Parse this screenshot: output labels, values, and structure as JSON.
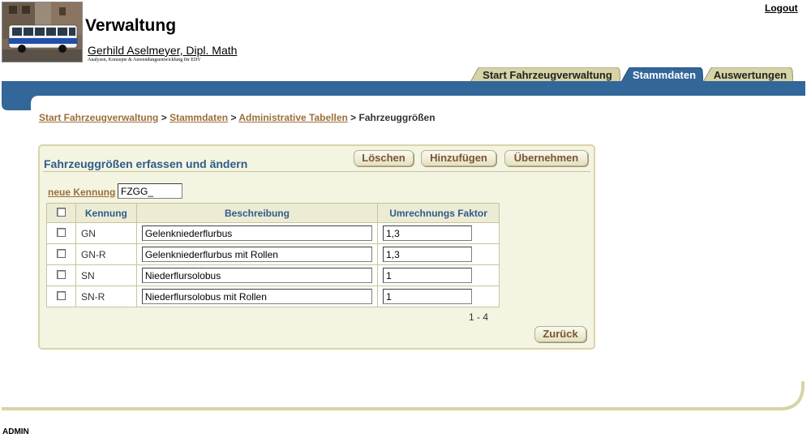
{
  "header": {
    "app_title": "Verwaltung",
    "subtitle_name": "Gerhild Aselmeyer, Dipl. Math",
    "subtitle_tagline": "Analysen, Konzepte & Anwendungsentwicklung für EDV",
    "logout_label": "Logout"
  },
  "tabs": [
    {
      "label": "Start Fahrzeugverwaltung",
      "active": false
    },
    {
      "label": "Stammdaten",
      "active": true
    },
    {
      "label": "Auswertungen",
      "active": false
    }
  ],
  "breadcrumb": {
    "items": [
      "Start Fahrzeugverwaltung",
      "Stammdaten",
      "Administrative Tabellen"
    ],
    "separator": ">",
    "current": "Fahrzeuggrößen"
  },
  "panel": {
    "title": "Fahrzeuggrößen erfassen und ändern",
    "buttons": {
      "delete": "Löschen",
      "add": "Hinzufügen",
      "apply": "Übernehmen",
      "back": "Zurück"
    },
    "new_kennung_label": "neue Kennung",
    "new_kennung_value": "FZGG_",
    "columns": [
      "Kennung",
      "Beschreibung",
      "Umrechnungs Faktor"
    ],
    "rows": [
      {
        "kennung": "GN",
        "beschreibung": "Gelenkniederflurbus",
        "faktor": "1,3"
      },
      {
        "kennung": "GN-R",
        "beschreibung": "Gelenkniederflurbus mit Rollen",
        "faktor": "1,3"
      },
      {
        "kennung": "SN",
        "beschreibung": "Niederflursolobus",
        "faktor": "1"
      },
      {
        "kennung": "SN-R",
        "beschreibung": "Niederflursolobus mit Rollen",
        "faktor": "1"
      }
    ],
    "pager": "1 - 4"
  },
  "footer": {
    "user": "ADMIN"
  },
  "colors": {
    "brand_blue": "#336699",
    "tab_active": "#336699",
    "tab_inactive": "#d6d3a6",
    "panel_bg": "#f4f4e2",
    "link_brown": "#9b6f3a"
  }
}
